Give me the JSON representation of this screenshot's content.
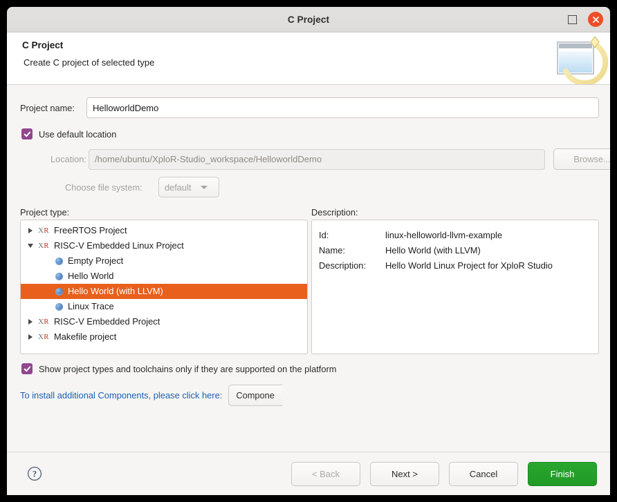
{
  "window": {
    "title": "C Project",
    "maximize_icon": "maximize-square-icon",
    "close_icon": "close-x-icon"
  },
  "header": {
    "title": "C Project",
    "subtitle": "Create C project of selected type",
    "banner_icon": "new-project-wizard-icon"
  },
  "form": {
    "project_name_label": "Project name:",
    "project_name_value": "HelloworldDemo",
    "use_default_location_label": "Use default location",
    "use_default_location_checked": true,
    "location_label": "Location:",
    "location_value": "/home/ubuntu/XploR-Studio_workspace/HelloworldDemo",
    "browse_label": "Browse...",
    "file_system_label": "Choose file system:",
    "file_system_value": "default"
  },
  "project_type": {
    "label": "Project type:",
    "nodes": [
      {
        "label": "FreeRTOS Project",
        "level": 0,
        "icon": "xr-icon",
        "twisty": "collapsed",
        "selected": false
      },
      {
        "label": "RISC-V Embedded Linux Project",
        "level": 0,
        "icon": "xr-icon",
        "twisty": "expanded",
        "selected": false
      },
      {
        "label": "Empty Project",
        "level": 1,
        "icon": "sphere-icon",
        "twisty": "none",
        "selected": false
      },
      {
        "label": "Hello World",
        "level": 1,
        "icon": "sphere-icon",
        "twisty": "none",
        "selected": false
      },
      {
        "label": "Hello World (with LLVM)",
        "level": 1,
        "icon": "sphere-icon",
        "twisty": "none",
        "selected": true
      },
      {
        "label": "Linux Trace",
        "level": 1,
        "icon": "sphere-icon",
        "twisty": "none",
        "selected": false
      },
      {
        "label": "RISC-V Embedded Project",
        "level": 0,
        "icon": "xr-icon",
        "twisty": "collapsed",
        "selected": false
      },
      {
        "label": "Makefile project",
        "level": 0,
        "icon": "xr-icon",
        "twisty": "collapsed",
        "selected": false
      }
    ]
  },
  "description": {
    "label": "Description:",
    "rows": [
      {
        "key": "Id:",
        "value": "linux-helloworld-llvm-example"
      },
      {
        "key": "Name:",
        "value": "Hello World (with LLVM)"
      },
      {
        "key": "Description:",
        "value": "Hello World Linux Project for XploR Studio"
      }
    ]
  },
  "options": {
    "show_supported_label": "Show project types and toolchains only if they are supported on the platform",
    "show_supported_checked": true,
    "components_hint": "To install additional Components, please click here:",
    "components_button": "Compone"
  },
  "footer": {
    "help_icon": "help-question-icon",
    "back_label": "< Back",
    "back_disabled": true,
    "next_label": "Next >",
    "cancel_label": "Cancel",
    "finish_label": "Finish"
  },
  "colors": {
    "selection": "#e8601c",
    "checkbox": "#91468f",
    "finish": "#22a02a",
    "link": "#1a5fb4",
    "close": "#ef4f28"
  }
}
